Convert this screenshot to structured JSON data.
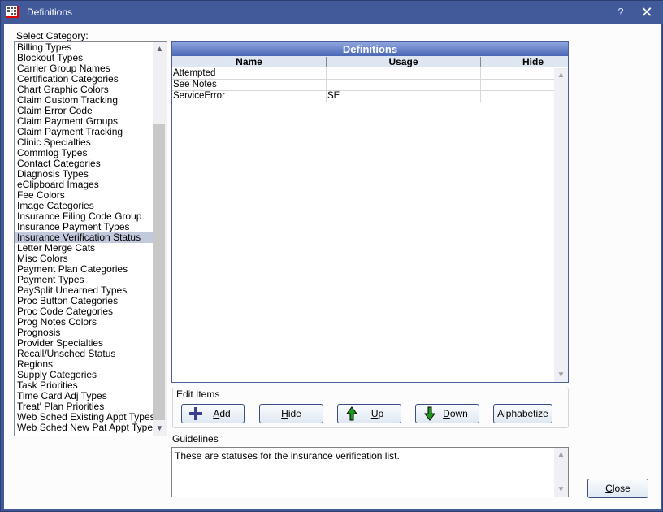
{
  "window": {
    "title": "Definitions",
    "help_label": "?",
    "close_label": "✕"
  },
  "categories": {
    "label": "Select Category:",
    "selected": "Insurance Verification Status",
    "items": [
      "Billing Types",
      "Blockout Types",
      "Carrier Group Names",
      "Certification Categories",
      "Chart Graphic Colors",
      "Claim Custom Tracking",
      "Claim Error Code",
      "Claim Payment Groups",
      "Claim Payment Tracking",
      "Clinic Specialties",
      "Commlog Types",
      "Contact Categories",
      "Diagnosis Types",
      "eClipboard Images",
      "Fee Colors",
      "Image Categories",
      "Insurance Filing Code Group",
      "Insurance Payment Types",
      "Insurance Verification Status",
      "Letter Merge Cats",
      "Misc Colors",
      "Payment Plan Categories",
      "Payment Types",
      "PaySplit Unearned Types",
      "Proc Button Categories",
      "Proc Code Categories",
      "Prog Notes Colors",
      "Prognosis",
      "Provider Specialties",
      "Recall/Unsched Status",
      "Regions",
      "Supply Categories",
      "Task Priorities",
      "Time Card Adj Types",
      "Treat' Plan Priorities",
      "Web Sched Existing Appt Types",
      "Web Sched New Pat Appt Types"
    ],
    "scroll_up_icon": "▲",
    "scroll_down_icon": "▼"
  },
  "grid": {
    "title": "Definitions",
    "columns": [
      "Name",
      "Usage",
      "",
      "Hide"
    ],
    "rows": [
      {
        "name": "Attempted",
        "usage": "",
        "extra": "",
        "hide": ""
      },
      {
        "name": "See Notes",
        "usage": "",
        "extra": "",
        "hide": ""
      },
      {
        "name": "ServiceError",
        "usage": "SE",
        "extra": "",
        "hide": ""
      }
    ]
  },
  "edit_items": {
    "label": "Edit Items",
    "buttons": {
      "add": {
        "prefix": "",
        "mnemonic": "A",
        "rest": "dd",
        "icon": "plus-icon"
      },
      "hide": {
        "prefix": "",
        "mnemonic": "H",
        "rest": "ide"
      },
      "up": {
        "prefix": "",
        "mnemonic": "U",
        "rest": "p",
        "icon": "arrow-up-icon"
      },
      "down": {
        "prefix": "",
        "mnemonic": "D",
        "rest": "own",
        "icon": "arrow-down-icon"
      },
      "alphabetize": {
        "label": "Alphabetize"
      }
    }
  },
  "guidelines": {
    "label": "Guidelines",
    "text": "These are statuses for the insurance verification list."
  },
  "footer": {
    "close": {
      "mnemonic": "C",
      "rest": "lose"
    }
  },
  "colors": {
    "titlebar": "#42599a",
    "grid_header": "#4a67b5",
    "selection": "#c3c9dc",
    "arrow_green": "#1a9a1a",
    "plus_navy": "#3b3f8f"
  }
}
